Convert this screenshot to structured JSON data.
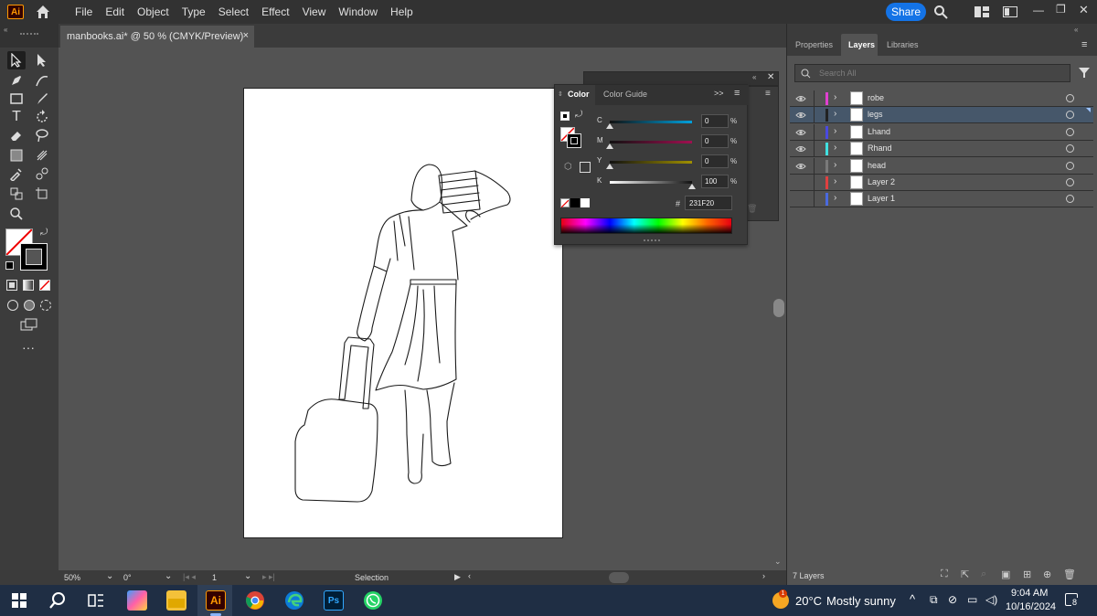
{
  "app": {
    "logo_text": "Ai",
    "menu": [
      "File",
      "Edit",
      "Object",
      "Type",
      "Select",
      "Effect",
      "View",
      "Window",
      "Help"
    ],
    "share_label": "Share"
  },
  "document": {
    "tab_title": "manbooks.ai* @ 50 % (CMYK/Preview)",
    "close_glyph": "×"
  },
  "status": {
    "zoom": "50%",
    "rotation": "0°",
    "artboard": "1",
    "tool": "Selection"
  },
  "panels": {
    "tabs": [
      "Properties",
      "Layers",
      "Libraries"
    ],
    "active_tab": "Layers",
    "search_placeholder": "Search All",
    "layers": [
      {
        "name": "robe",
        "color": "#e040d0",
        "visible": true,
        "selected": false
      },
      {
        "name": "legs",
        "color": "#222222",
        "visible": true,
        "selected": true
      },
      {
        "name": "Lhand",
        "color": "#4a4adf",
        "visible": true,
        "selected": false
      },
      {
        "name": "Rhand",
        "color": "#40e0e0",
        "visible": true,
        "selected": false
      },
      {
        "name": "head",
        "color": "#7a7a7a",
        "visible": true,
        "selected": false
      },
      {
        "name": "Layer 2",
        "color": "#e04040",
        "visible": false,
        "selected": false
      },
      {
        "name": "Layer 1",
        "color": "#4a6adf",
        "visible": false,
        "selected": false
      }
    ],
    "layer_count": "7 Layers"
  },
  "color_panel": {
    "tabs": [
      "Color",
      "Color Guide"
    ],
    "sliders": [
      {
        "label": "C",
        "value": "0",
        "level": 0
      },
      {
        "label": "M",
        "value": "0",
        "level": 0
      },
      {
        "label": "Y",
        "value": "0",
        "level": 0
      },
      {
        "label": "K",
        "value": "100",
        "level": 100
      }
    ],
    "percent": "%",
    "hex_label": "#",
    "hex_value": "231F20"
  },
  "taskbar": {
    "weather_temp": "20°C",
    "weather_text": "Mostly sunny",
    "time": "9:04 AM",
    "date": "10/16/2024",
    "notification_count": "8",
    "weather_badge": "1"
  }
}
